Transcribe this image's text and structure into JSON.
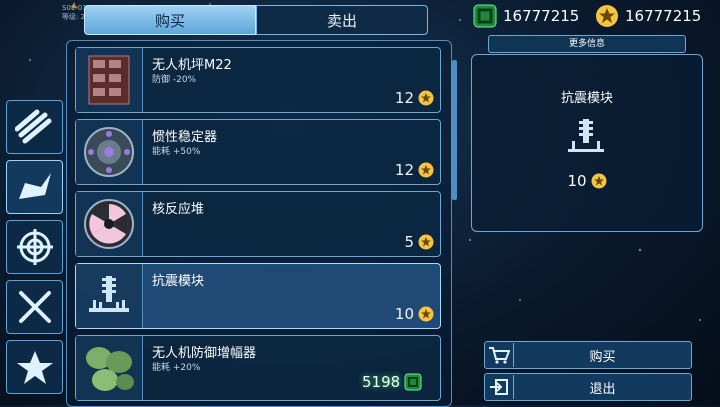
{
  "overlay": {
    "line1": "S01-01-S",
    "line2": "等级: 2"
  },
  "tabs": {
    "buy": "购买",
    "sell": "卖出"
  },
  "categories": [
    {
      "icon": "pipes-icon"
    },
    {
      "icon": "claw-icon"
    },
    {
      "icon": "target-icon"
    },
    {
      "icon": "tools-icon"
    },
    {
      "icon": "star-icon"
    }
  ],
  "items": [
    {
      "name": "无人机坪M22",
      "effect": "防御 -20%",
      "price": "12",
      "icon": "drone-pad-icon"
    },
    {
      "name": "惯性稳定器",
      "effect": "能耗 +50%",
      "price": "12",
      "icon": "inertial-stabilizer-icon"
    },
    {
      "name": "核反应堆",
      "effect": "",
      "price": "5",
      "icon": "nuclear-reactor-icon"
    },
    {
      "name": "抗震模块",
      "effect": "",
      "price": "10",
      "icon": "anti-shock-module-icon"
    },
    {
      "name": "无人机防御增幅器",
      "effect": "能耗 +20%",
      "price": "",
      "icon": "drone-defense-booster-icon"
    }
  ],
  "balance": {
    "green": "5198"
  },
  "currency": {
    "cubes": "16777215",
    "stars": "16777215"
  },
  "info": {
    "more_label": "更多信息",
    "item_name": "抗震模块",
    "price": "10"
  },
  "actions": {
    "buy": "购买",
    "exit": "退出"
  },
  "colors": {
    "accent": "#6aa8d8",
    "star": "#f5c542",
    "cube": "#3ddc6a"
  }
}
